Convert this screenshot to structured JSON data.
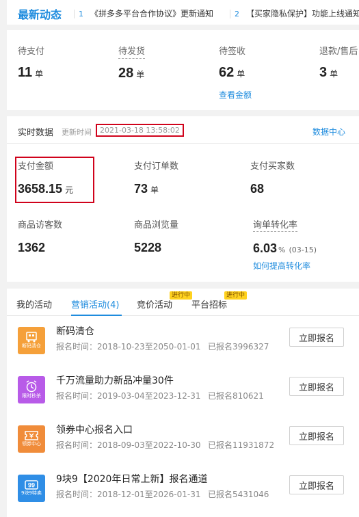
{
  "news": {
    "title": "最新动态",
    "items": [
      {
        "num": "1",
        "text": "《拼多多平台合作协议》更新通知"
      },
      {
        "num": "2",
        "text": "【买家隐私保护】功能上线通知"
      }
    ]
  },
  "orders": {
    "items": [
      {
        "label": "待支付",
        "value": "11",
        "unit": "单"
      },
      {
        "label": "待发货",
        "value": "28",
        "unit": "单"
      },
      {
        "label": "待签收",
        "value": "62",
        "unit": "单"
      },
      {
        "label": "退款/售后",
        "value": "3",
        "unit": "单"
      }
    ],
    "link": "查看金额"
  },
  "realtime": {
    "title": "实时数据",
    "update_label": "更新时间",
    "update_time": "2021-03-18 13:58:02",
    "center_link": "数据中心",
    "metrics": [
      {
        "label": "支付金额",
        "value": "3658.15",
        "unit": "元"
      },
      {
        "label": "支付订单数",
        "value": "73",
        "unit": "单"
      },
      {
        "label": "支付买家数",
        "value": "68",
        "unit": ""
      },
      {
        "label": "商品访客数",
        "value": "1362",
        "unit": ""
      },
      {
        "label": "商品浏览量",
        "value": "5228",
        "unit": ""
      },
      {
        "label": "询单转化率",
        "value": "6.03",
        "unit": "%",
        "sub": "(03-15)"
      }
    ],
    "improve_link": "如何提高转化率"
  },
  "activities": {
    "tabs": [
      {
        "label": "我的活动"
      },
      {
        "label": "营销活动(4)"
      },
      {
        "label": "竞价活动",
        "tag": "进行中"
      },
      {
        "label": "平台招标",
        "tag": "进行中"
      }
    ],
    "items": [
      {
        "name": "断码清仓",
        "date": "报名时间：2018-10-23至2050-01-01",
        "count": "已报名3996327",
        "button": "立即报名",
        "icon": "clearance-truck-icon",
        "icon_caption": "断码清仓",
        "color": "#f5a03a"
      },
      {
        "name": "千万流量助力新品冲量30件",
        "date": "报名时间：2019-03-04至2023-12-31",
        "count": "已报名810621",
        "button": "立即报名",
        "icon": "alarm-clock-icon",
        "icon_caption": "限时秒杀",
        "color": "#b85be8"
      },
      {
        "name": "领券中心报名入口",
        "date": "报名时间：2018-09-03至2022-10-30",
        "count": "已报名11931872",
        "button": "立即报名",
        "icon": "coupon-icon",
        "icon_caption": "领券中心",
        "color": "#f08c3a"
      },
      {
        "name": "9块9【2020年日常上新】报名通道",
        "date": "报名时间：2018-12-01至2026-01-31",
        "count": "已报名5431046",
        "button": "立即报名",
        "icon": "nine-nine-icon",
        "icon_caption": "9块9特卖",
        "color": "#2f8ee6"
      }
    ]
  }
}
